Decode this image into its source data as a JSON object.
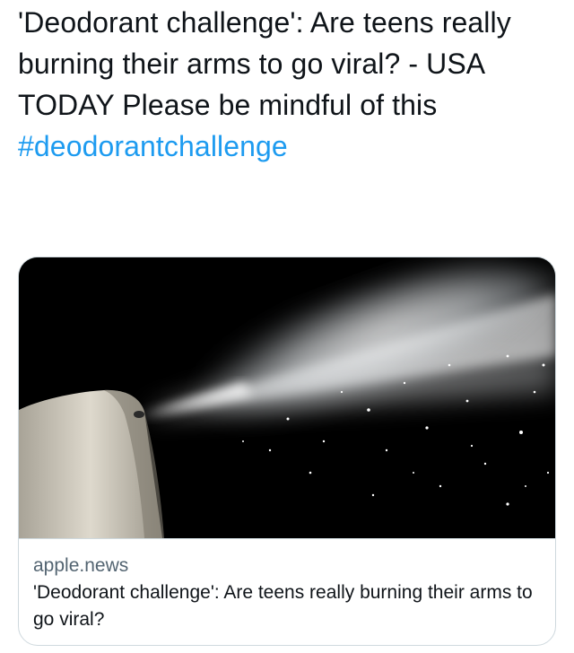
{
  "tweet": {
    "text": "'Deodorant challenge': Are teens really burning their arms to go viral? - USA TODAY Please be mindful of this",
    "hashtag": "#deodorantchallenge",
    "link_color": "#1d9bf0"
  },
  "link_card": {
    "domain": "apple.news",
    "title": "'Deodorant challenge': Are teens really burning their arms to go viral?",
    "image_description_icon": "aerosol-spray-image"
  }
}
